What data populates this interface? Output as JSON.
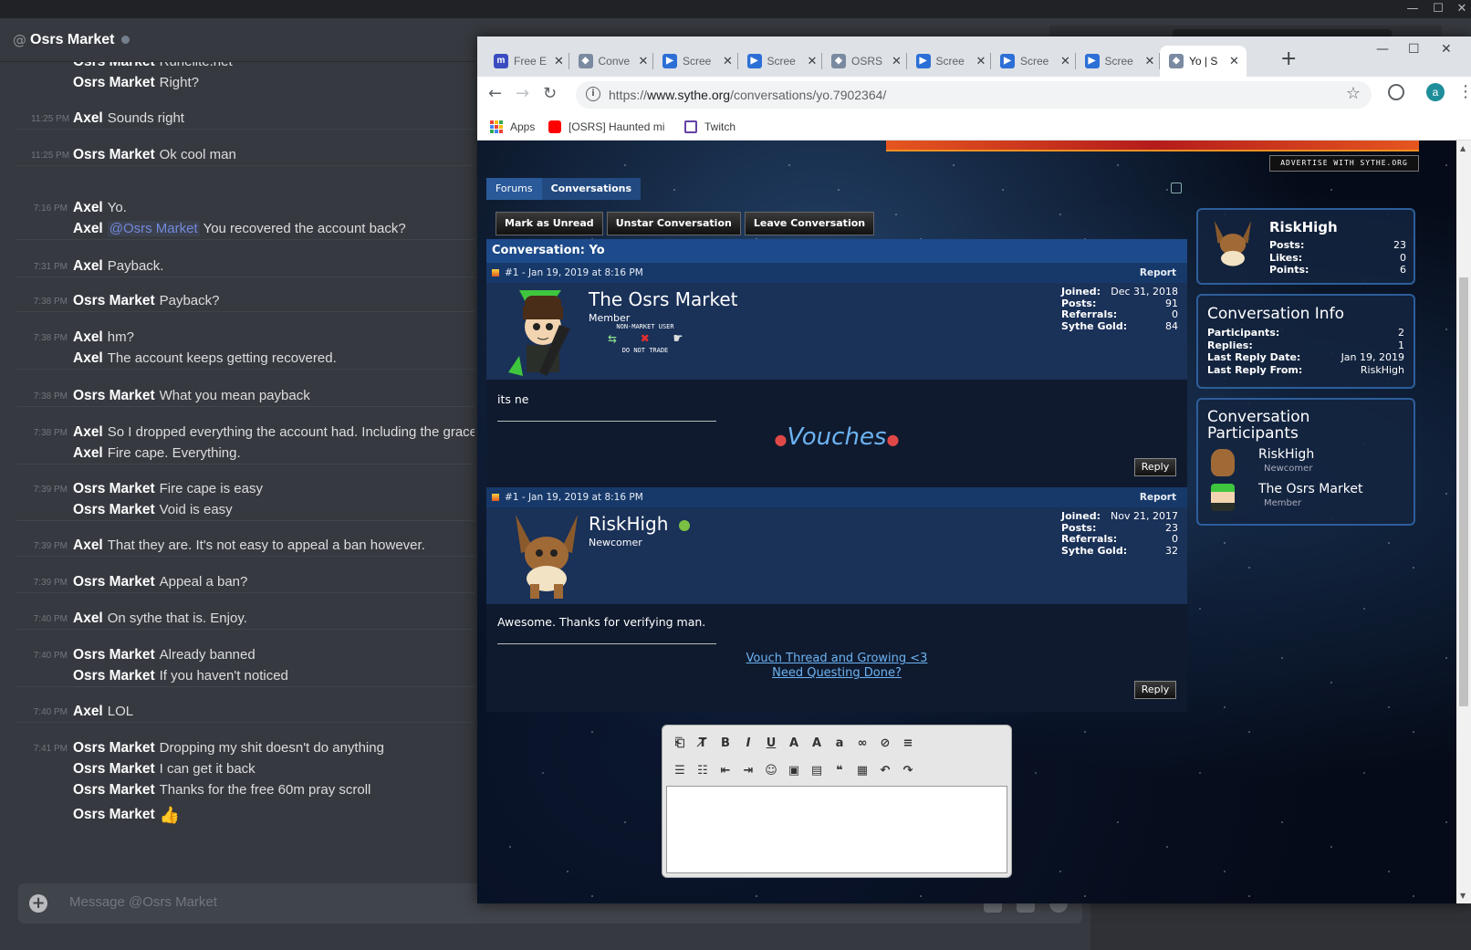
{
  "discord": {
    "header": {
      "at": "@",
      "title": "Osrs Market"
    },
    "groups": [
      {
        "ts": "",
        "msgs": [
          {
            "author": "Osrs Market",
            "text": "Runelite.net"
          },
          {
            "author": "Osrs Market",
            "text": "Right?"
          }
        ]
      },
      {
        "ts": "11:25 PM",
        "msgs": [
          {
            "author": "Axel",
            "text": "Sounds right"
          }
        ]
      },
      {
        "ts": "11:25 PM",
        "msgs": [
          {
            "author": "Osrs Market",
            "text": "Ok cool man"
          }
        ]
      },
      {
        "ts": "7:16 PM",
        "msgs": [
          {
            "author": "Axel",
            "text": "Yo."
          },
          {
            "author": "Axel",
            "mention": "@Osrs Market",
            "text": "You recovered the account back?"
          }
        ]
      },
      {
        "ts": "7:31 PM",
        "msgs": [
          {
            "author": "Axel",
            "text": "Payback."
          }
        ]
      },
      {
        "ts": "7:38 PM",
        "msgs": [
          {
            "author": "Osrs Market",
            "text": "Payback?"
          }
        ]
      },
      {
        "ts": "7:38 PM",
        "msgs": [
          {
            "author": "Axel",
            "text": "hm?"
          },
          {
            "author": "Axel",
            "text": "The account keeps getting recovered."
          }
        ]
      },
      {
        "ts": "7:38 PM",
        "msgs": [
          {
            "author": "Osrs Market",
            "text": "What you mean payback"
          }
        ]
      },
      {
        "ts": "7:38 PM",
        "msgs": [
          {
            "author": "Axel",
            "text": "So I dropped everything the account had. Including the graceful."
          },
          {
            "author": "Axel",
            "text": "Fire cape. Everything."
          }
        ]
      },
      {
        "ts": "7:39 PM",
        "msgs": [
          {
            "author": "Osrs Market",
            "text": "Fire cape is easy"
          },
          {
            "author": "Osrs Market",
            "text": "Void is easy"
          }
        ]
      },
      {
        "ts": "7:39 PM",
        "msgs": [
          {
            "author": "Axel",
            "text": "That they are. It's not easy to appeal a ban however."
          }
        ]
      },
      {
        "ts": "7:39 PM",
        "msgs": [
          {
            "author": "Osrs Market",
            "text": "Appeal a ban?"
          }
        ]
      },
      {
        "ts": "7:40 PM",
        "msgs": [
          {
            "author": "Axel",
            "text": "On sythe that is. Enjoy."
          }
        ]
      },
      {
        "ts": "7:40 PM",
        "msgs": [
          {
            "author": "Osrs Market",
            "text": "Already banned"
          },
          {
            "author": "Osrs Market",
            "text": "If you haven't noticed"
          }
        ]
      },
      {
        "ts": "7:40 PM",
        "msgs": [
          {
            "author": "Axel",
            "text": "LOL"
          }
        ]
      },
      {
        "ts": "7:41 PM",
        "msgs": [
          {
            "author": "Osrs Market",
            "text": "Dropping my shit doesn't do anything"
          },
          {
            "author": "Osrs Market",
            "text": "I can get it back"
          },
          {
            "author": "Osrs Market",
            "text": "Thanks for the free 60m pray scroll"
          },
          {
            "author": "Osrs Market",
            "text": "👍"
          }
        ]
      }
    ],
    "composer_placeholder": "Message @Osrs Market"
  },
  "chrome": {
    "tabs": [
      {
        "title": "Free E",
        "color": "#3b4cc0",
        "glyph": "m"
      },
      {
        "title": "Conve",
        "color": "#7a8aa0",
        "glyph": "◆"
      },
      {
        "title": "Scree",
        "color": "#2c6fd6",
        "glyph": "▶"
      },
      {
        "title": "Scree",
        "color": "#2c6fd6",
        "glyph": "▶"
      },
      {
        "title": "OSRS",
        "color": "#7a8aa0",
        "glyph": "◆"
      },
      {
        "title": "Scree",
        "color": "#2c6fd6",
        "glyph": "▶"
      },
      {
        "title": "Scree",
        "color": "#2c6fd6",
        "glyph": "▶"
      },
      {
        "title": "Scree",
        "color": "#2c6fd6",
        "glyph": "▶"
      },
      {
        "title": "Yo | S",
        "color": "#7a8aa0",
        "glyph": "◆"
      }
    ],
    "url_prefix": "https://",
    "url_host": "www.sythe.org",
    "url_path": "/conversations/yo.7902364/",
    "avatar_letter": "a",
    "bookmarks": [
      "Apps",
      "[OSRS] Haunted mine",
      "Twitch"
    ]
  },
  "page": {
    "advertise": "ADVERTISE WITH SYTHE.ORG",
    "breadcrumb": [
      "Forums",
      "Conversations"
    ],
    "actions": [
      "Mark as Unread",
      "Unstar Conversation",
      "Leave Conversation"
    ],
    "conversation_title": "Conversation: Yo",
    "posts": [
      {
        "meta": "#1 - Jan 19, 2019 at 8:16 PM",
        "report": "Report",
        "name": "The Osrs Market",
        "rank": "Member",
        "badge_top": "NON-MARKET USER",
        "badge_bottom": "DO NOT TRADE",
        "stats": [
          [
            "Joined:",
            "Dec 31, 2018"
          ],
          [
            "Posts:",
            "91"
          ],
          [
            "Referrals:",
            "0"
          ],
          [
            "Sythe Gold:",
            "84"
          ]
        ],
        "body": "its ne",
        "sig": "Vouches",
        "reply": "Reply"
      },
      {
        "meta": "#1 - Jan 19, 2019 at 8:16 PM",
        "report": "Report",
        "name": "RiskHigh",
        "rank": "Newcomer",
        "stats": [
          [
            "Joined:",
            "Nov 21, 2017"
          ],
          [
            "Posts:",
            "23"
          ],
          [
            "Referrals:",
            "0"
          ],
          [
            "Sythe Gold:",
            "32"
          ]
        ],
        "body": "Awesome. Thanks for verifying man.",
        "sig_links": [
          "Vouch Thread and Growing <3",
          "Need Questing Done?"
        ],
        "reply": "Reply"
      }
    ],
    "sidebar": {
      "user": {
        "name": "RiskHigh",
        "stats": [
          [
            "Posts:",
            "23"
          ],
          [
            "Likes:",
            "0"
          ],
          [
            "Points:",
            "6"
          ]
        ]
      },
      "info": {
        "title": "Conversation Info",
        "rows": [
          [
            "Participants:",
            "2"
          ],
          [
            "Replies:",
            "1"
          ],
          [
            "Last Reply Date:",
            "Jan 19, 2019"
          ],
          [
            "Last Reply From:",
            "RiskHigh"
          ]
        ]
      },
      "participants": {
        "title": "Conversation Participants",
        "list": [
          {
            "name": "RiskHigh",
            "rank": "Newcomer"
          },
          {
            "name": "The Osrs Market",
            "rank": "Member"
          }
        ]
      }
    }
  }
}
